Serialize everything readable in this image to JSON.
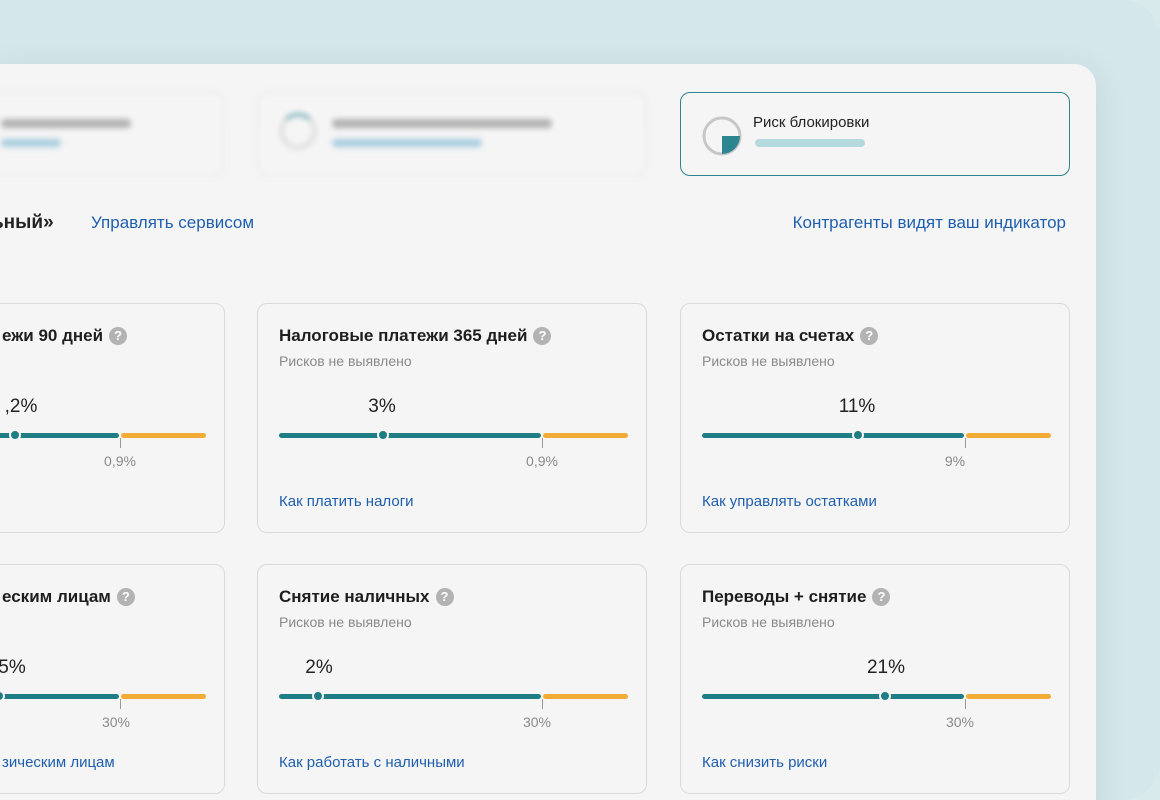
{
  "status": {
    "block_risk_title": "Риск блокировки",
    "colors": {
      "accent": "#2d8590",
      "track": "#1f7e84",
      "warn": "#f2ab35",
      "link": "#1f5fae"
    }
  },
  "header": {
    "section_title_fragment": "ьный»",
    "manage_link": "Управлять сервисом",
    "visibility_link": "Контрагенты видят ваш индикатор"
  },
  "cards": [
    {
      "title": "ежи 90 дней",
      "subtitle": "",
      "value": ",2%",
      "value_fraction": 0.0,
      "threshold": "0,9%",
      "link": ""
    },
    {
      "title": "Налоговые платежи 365 дней",
      "subtitle": "Рисков не выявлено",
      "value": "3%",
      "value_fraction": 0.3,
      "threshold": "0,9%",
      "link": "Как платить налоги"
    },
    {
      "title": "Остатки на счетах",
      "subtitle": "Рисков не выявлено",
      "value": "11%",
      "value_fraction": 0.45,
      "threshold": "9%",
      "link": "Как управлять остатками"
    },
    {
      "title": "еским лицам",
      "subtitle": "",
      "value": "5%",
      "value_fraction": 0.0,
      "threshold": "30%",
      "link": "зическим лицам"
    },
    {
      "title": "Снятие наличных",
      "subtitle": "Рисков не выявлено",
      "value": "2%",
      "value_fraction": 0.11,
      "threshold": "30%",
      "link": "Как работать с наличными"
    },
    {
      "title": "Переводы + снятие",
      "subtitle": "Рисков не выявлено",
      "value": "21%",
      "value_fraction": 0.53,
      "threshold": "30%",
      "link": "Как снизить риски"
    }
  ],
  "help_glyph": "?"
}
